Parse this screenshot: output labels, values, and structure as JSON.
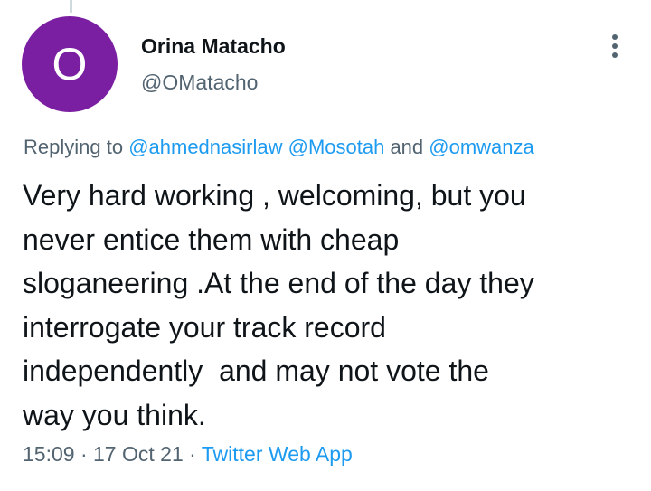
{
  "tweet": {
    "author": {
      "avatar_initial": "O",
      "avatar_color": "#7b1fa2",
      "display_name": "Orina Matacho",
      "handle": "@OMatacho"
    },
    "more_icon": "more-vertical-icon",
    "replying": {
      "prefix": "Replying to ",
      "mentions": [
        "@ahmednasirlaw",
        "@Mosotah",
        "@omwanza"
      ],
      "separator": " ",
      "conjunction": " and "
    },
    "text_lines": [
      "Very hard working , welcoming, but you",
      "never entice them with cheap",
      "sloganeering .At the end of the day they",
      "interrogate your track record",
      "independently  and may not vote the",
      "way you think."
    ],
    "meta": {
      "time": "15:09",
      "dot": " · ",
      "date": "17 Oct 21",
      "source": "Twitter Web App"
    }
  },
  "colors": {
    "link": "#1d9bf0",
    "secondary_text": "#536471",
    "primary_text": "#0f1419",
    "thread_line": "#cfd9de"
  }
}
